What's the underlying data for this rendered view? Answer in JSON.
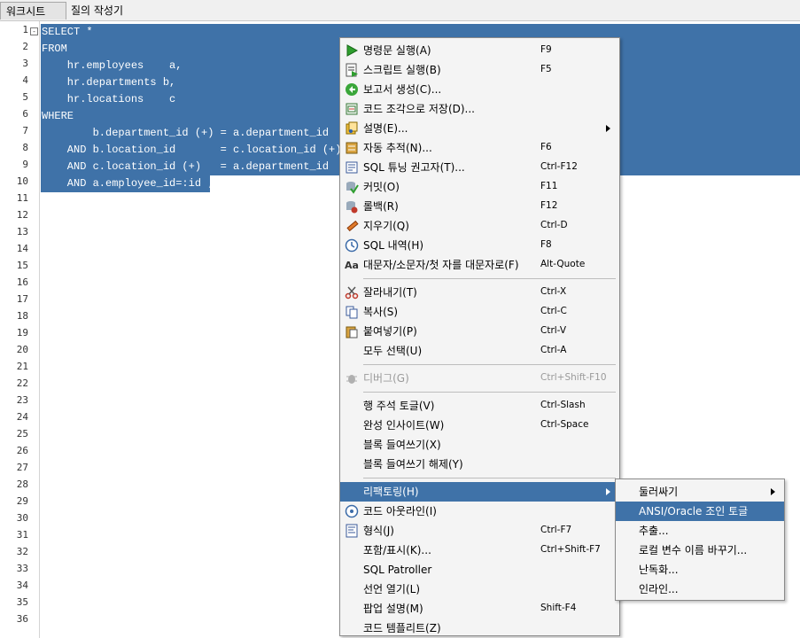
{
  "tabs": [
    "워크시트",
    "질의 작성기"
  ],
  "gutter": {
    "line_numbers": [
      "1",
      "2",
      "3",
      "4",
      "5",
      "6",
      "7",
      "8",
      "9",
      "10",
      "11",
      "12",
      "13",
      "14",
      "15",
      "16",
      "17",
      "18",
      "19",
      "20",
      "21",
      "22",
      "23",
      "24",
      "25",
      "26",
      "27",
      "28",
      "29",
      "30",
      "31",
      "32",
      "33",
      "34",
      "35",
      "36"
    ],
    "fold_marker": "-"
  },
  "code_lines": [
    "SELECT *",
    "FROM",
    "    hr.employees    a,",
    "    hr.departments b,",
    "    hr.locations    c",
    "WHERE",
    "        b.department_id (+) = a.department_id",
    "    AND b.location_id       = c.location_id (+)",
    "    AND c.location_id (+)   = a.department_id",
    "    AND a.employee_id=:id ;"
  ],
  "context_menu": [
    {
      "type": "item",
      "icon": "run-statement-icon",
      "label": "명령문 실행(A)",
      "shortcut": "F9"
    },
    {
      "type": "item",
      "icon": "run-script-icon",
      "label": "스크립트 실행(B)",
      "shortcut": "F5"
    },
    {
      "type": "item",
      "icon": "create-report-icon",
      "label": "보고서 생성(C)...",
      "shortcut": ""
    },
    {
      "type": "item",
      "icon": "save-snippet-icon",
      "label": "코드 조각으로 저장(D)...",
      "shortcut": ""
    },
    {
      "type": "item",
      "icon": "explain-icon",
      "label": "설명(E)...",
      "shortcut": "",
      "submenu": true
    },
    {
      "type": "item",
      "icon": "autotrace-icon",
      "label": "자동 추적(N)...",
      "shortcut": "F6"
    },
    {
      "type": "item",
      "icon": "sql-tuning-advisor-icon",
      "label": "SQL 튜닝 권고자(T)...",
      "shortcut": "Ctrl-F12"
    },
    {
      "type": "item",
      "icon": "commit-icon",
      "label": "커밋(O)",
      "shortcut": "F11"
    },
    {
      "type": "item",
      "icon": "rollback-icon",
      "label": "롤백(R)",
      "shortcut": "F12"
    },
    {
      "type": "item",
      "icon": "clear-icon",
      "label": "지우기(Q)",
      "shortcut": "Ctrl-D"
    },
    {
      "type": "item",
      "icon": "sql-history-icon",
      "label": "SQL 내역(H)",
      "shortcut": "F8"
    },
    {
      "type": "item",
      "icon": "case-toggle-icon",
      "label": "대문자/소문자/첫 자를 대문자로(F)",
      "shortcut": "Alt-Quote"
    },
    {
      "type": "sep"
    },
    {
      "type": "item",
      "icon": "cut-icon",
      "label": "잘라내기(T)",
      "shortcut": "Ctrl-X"
    },
    {
      "type": "item",
      "icon": "copy-icon",
      "label": "복사(S)",
      "shortcut": "Ctrl-C"
    },
    {
      "type": "item",
      "icon": "paste-icon",
      "label": "붙여넣기(P)",
      "shortcut": "Ctrl-V"
    },
    {
      "type": "item",
      "icon": "",
      "label": "모두 선택(U)",
      "shortcut": "Ctrl-A"
    },
    {
      "type": "sep"
    },
    {
      "type": "item",
      "icon": "debug-icon",
      "label": "디버그(G)",
      "shortcut": "Ctrl+Shift-F10",
      "disabled": true
    },
    {
      "type": "sep"
    },
    {
      "type": "item",
      "icon": "",
      "label": "행 주석 토글(V)",
      "shortcut": "Ctrl-Slash"
    },
    {
      "type": "item",
      "icon": "",
      "label": "완성 인사이트(W)",
      "shortcut": "Ctrl-Space"
    },
    {
      "type": "item",
      "icon": "",
      "label": "블록 들여쓰기(X)",
      "shortcut": ""
    },
    {
      "type": "item",
      "icon": "",
      "label": "블록 들여쓰기 해제(Y)",
      "shortcut": ""
    },
    {
      "type": "sep"
    },
    {
      "type": "item",
      "icon": "",
      "label": "리팩토링(H)",
      "shortcut": "",
      "submenu": true,
      "highlighted": true
    },
    {
      "type": "item",
      "icon": "code-outline-icon",
      "label": "코드 아웃라인(I)",
      "shortcut": ""
    },
    {
      "type": "item",
      "icon": "format-icon",
      "label": "형식(J)",
      "shortcut": "Ctrl-F7"
    },
    {
      "type": "item",
      "icon": "",
      "label": "포함/표시(K)...",
      "shortcut": "Ctrl+Shift-F7"
    },
    {
      "type": "item",
      "icon": "",
      "label": "SQL Patroller",
      "shortcut": ""
    },
    {
      "type": "item",
      "icon": "",
      "label": "선언 열기(L)",
      "shortcut": ""
    },
    {
      "type": "item",
      "icon": "",
      "label": "팝업 설명(M)",
      "shortcut": "Shift-F4"
    },
    {
      "type": "item",
      "icon": "",
      "label": "코드 템플리트(Z)",
      "shortcut": ""
    }
  ],
  "submenu": [
    {
      "label": "둘러싸기",
      "submenu": true,
      "highlighted": false
    },
    {
      "label": "ANSI/Oracle 조인 토글",
      "highlighted": true
    },
    {
      "label": "추출...",
      "highlighted": false
    },
    {
      "label": "로컬 변수 이름 바꾸기...",
      "highlighted": false
    },
    {
      "label": "난독화...",
      "highlighted": false
    },
    {
      "label": "인라인...",
      "highlighted": false
    }
  ],
  "colors": {
    "selection": "#3f72a8",
    "menu_bg": "#f4f4f4"
  }
}
